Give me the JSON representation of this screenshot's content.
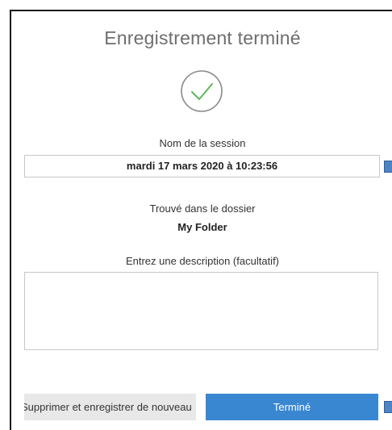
{
  "dialog": {
    "title": "Enregistrement terminé",
    "status_icon": "checkmark-circle-icon",
    "session_label": "Nom de la session",
    "session_value": "mardi 17 mars 2020 à 10:23:56",
    "folder_label": "Trouvé dans le dossier",
    "folder_value": "My Folder",
    "description_label": "Entrez une description (facultatif)",
    "description_value": "",
    "buttons": {
      "secondary_label": "Supprimer et enregistrer de nouveau",
      "primary_label": "Terminé"
    }
  },
  "colors": {
    "accent": "#3a87d1",
    "check": "#5cb85c",
    "circle": "#8a8a8a"
  }
}
